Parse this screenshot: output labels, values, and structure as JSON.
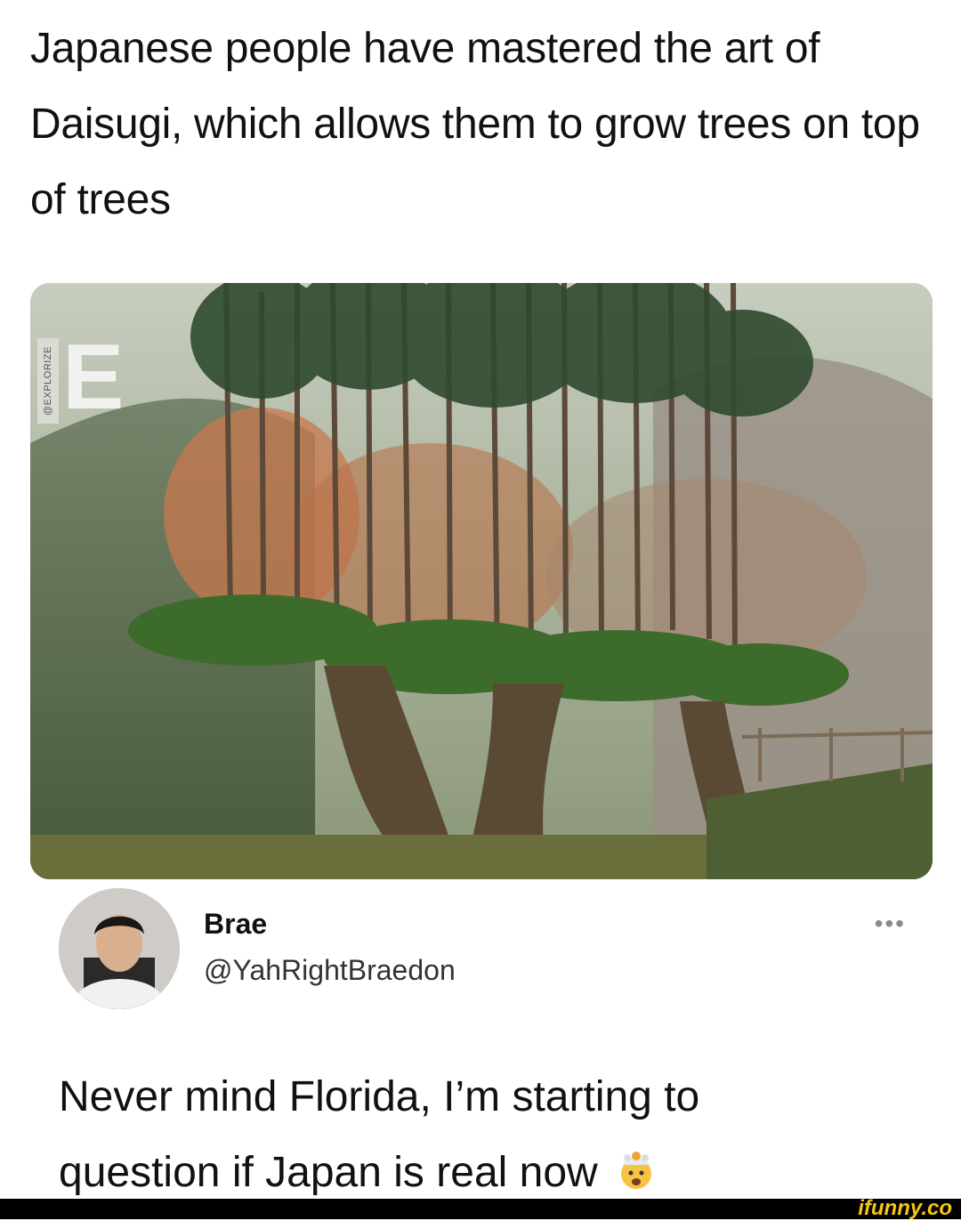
{
  "headline": "Japanese people have mastered the art of Daisugi, which allows them to grow trees on top of trees",
  "photo": {
    "watermark_letter": "E",
    "watermark_handle": "@EXPLORIZE"
  },
  "tweet": {
    "name": "Brae",
    "handle": "@YahRightBraedon",
    "more_icon": "more-icon",
    "text_line1": "Never mind Florida, I’m starting to",
    "text_line2": "question if Japan is real now",
    "emoji": "exploding-head-emoji"
  },
  "footer": {
    "brand": "ifunny.co"
  },
  "colors": {
    "background": "#ffffff",
    "text": "#111111",
    "brand_yellow": "#f6c50f"
  }
}
